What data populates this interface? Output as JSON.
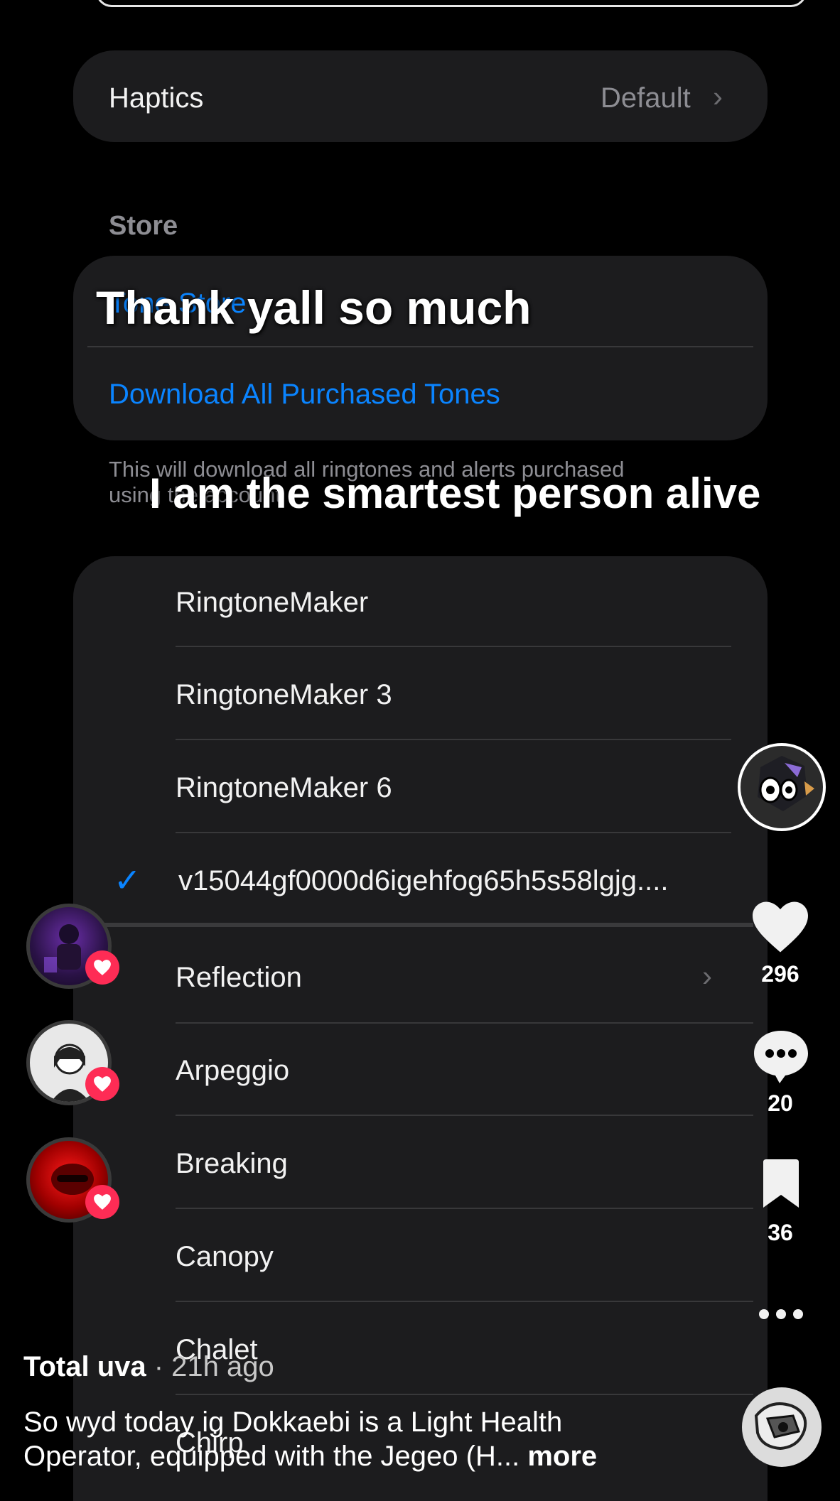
{
  "haptics": {
    "label": "Haptics",
    "value": "Default"
  },
  "store": {
    "header": "Store",
    "tone_store": "Tone Store",
    "download_all": "Download All Purchased Tones",
    "note_line1": "This will download all ringtones and alerts purchased",
    "note_line2": "using the account"
  },
  "tones": [
    {
      "label": "RingtoneMaker"
    },
    {
      "label": "RingtoneMaker 3"
    },
    {
      "label": "RingtoneMaker 6"
    },
    {
      "label": "v15044gf0000d6igehfog65h5s58lgjg...."
    },
    {
      "label": "Reflection"
    },
    {
      "label": "Arpeggio"
    },
    {
      "label": "Breaking"
    },
    {
      "label": "Canopy"
    },
    {
      "label": "Chalet"
    },
    {
      "label": "Chirp"
    }
  ],
  "overlay": {
    "line1": "Thank yall so much",
    "line2": "I am the smartest person alive"
  },
  "actions": {
    "likes": "296",
    "comments": "20",
    "saves": "36"
  },
  "post": {
    "author": "Total uva",
    "time": "· 21h ago",
    "caption_line1": "So wyd today ig Dokkaebi is a Light Health",
    "caption_line2": "Operator, equipped with the Jegeo (H...",
    "more": "more"
  },
  "colors": {
    "accent_blue": "#0a84ff",
    "like_red": "#fe2c55",
    "card_bg": "#1c1c1e"
  },
  "icons": [
    "chevron-right-icon",
    "checkmark-icon",
    "heart-icon",
    "comment-icon",
    "bookmark-icon",
    "more-icon"
  ]
}
